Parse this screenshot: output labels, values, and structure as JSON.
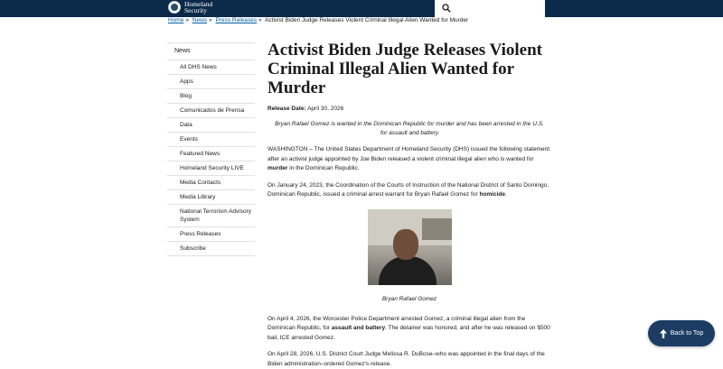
{
  "header": {
    "logo_line1": "Homeland",
    "logo_line2": "Security"
  },
  "breadcrumb": {
    "home": "Home",
    "news": "News",
    "press": "Press Releases",
    "current": "Activist Biden Judge Releases Violent Criminal Illegal Alien Wanted for Murder",
    "separator": "»"
  },
  "sidebar": {
    "heading": "News",
    "items": [
      {
        "label": "All DHS News"
      },
      {
        "label": "Apps"
      },
      {
        "label": "Blog"
      },
      {
        "label": "Comunicados de Prensa"
      },
      {
        "label": "Data"
      },
      {
        "label": "Events"
      },
      {
        "label": "Featured News"
      },
      {
        "label": "Homeland Security LIVE"
      },
      {
        "label": "Media Contacts"
      },
      {
        "label": "Media Library"
      },
      {
        "label": "National Terrorism Advisory System"
      },
      {
        "label": "Press Releases"
      },
      {
        "label": "Subscribe"
      }
    ]
  },
  "article": {
    "title": "Activist Biden Judge Releases Violent Criminal Illegal Alien Wanted for Murder",
    "release_label": "Release Date:",
    "release_date": "April 30, 2026",
    "subtitle": "Bryan Rafael Gomez is wanted in the Dominican Republic for murder and has been arrested in the U.S. for assault and battery",
    "p1_before": "WASHINGTON – The United States Department of Homeland Security (DHS) issued the following statement after an activist judge appointed by Joe Biden released a violent criminal illegal alien who is wanted for ",
    "p1_bold": "murder",
    "p1_after": " in the Dominican Republic.",
    "p2_before": "On January 24, 2023, the Coordination of the Courts of Instruction of the National District of Santo Domingo, Dominican Republic, issued a criminal arrest warrant for Bryan Rafael Gomez for ",
    "p2_bold": "homicide",
    "p2_after": ".",
    "caption": "Bryan Rafael Gomez",
    "p3_before": "On April 4, 2026, the Worcester Police Department arrested Gomez, a criminal illegal alien from the Dominican Republic, for ",
    "p3_bold": "assault and battery",
    "p3_after": ". The detainer was honored, and after he was released on $500 bail, ICE arrested Gomez.",
    "p4": "On April 28, 2026, U.S. District Court Judge Melissa R. DuBose–who was appointed in the final days of the Biden administration–ordered Gomez's release."
  },
  "back_to_top": {
    "label": "Back to Top"
  },
  "icons": {
    "search": "search-icon",
    "arrow_up": "arrow-up-icon",
    "seal": "dhs-seal-icon"
  },
  "colors": {
    "header_bg": "#0b2a4a",
    "link": "#005ea2",
    "back_to_top_bg": "#1c3c63"
  }
}
